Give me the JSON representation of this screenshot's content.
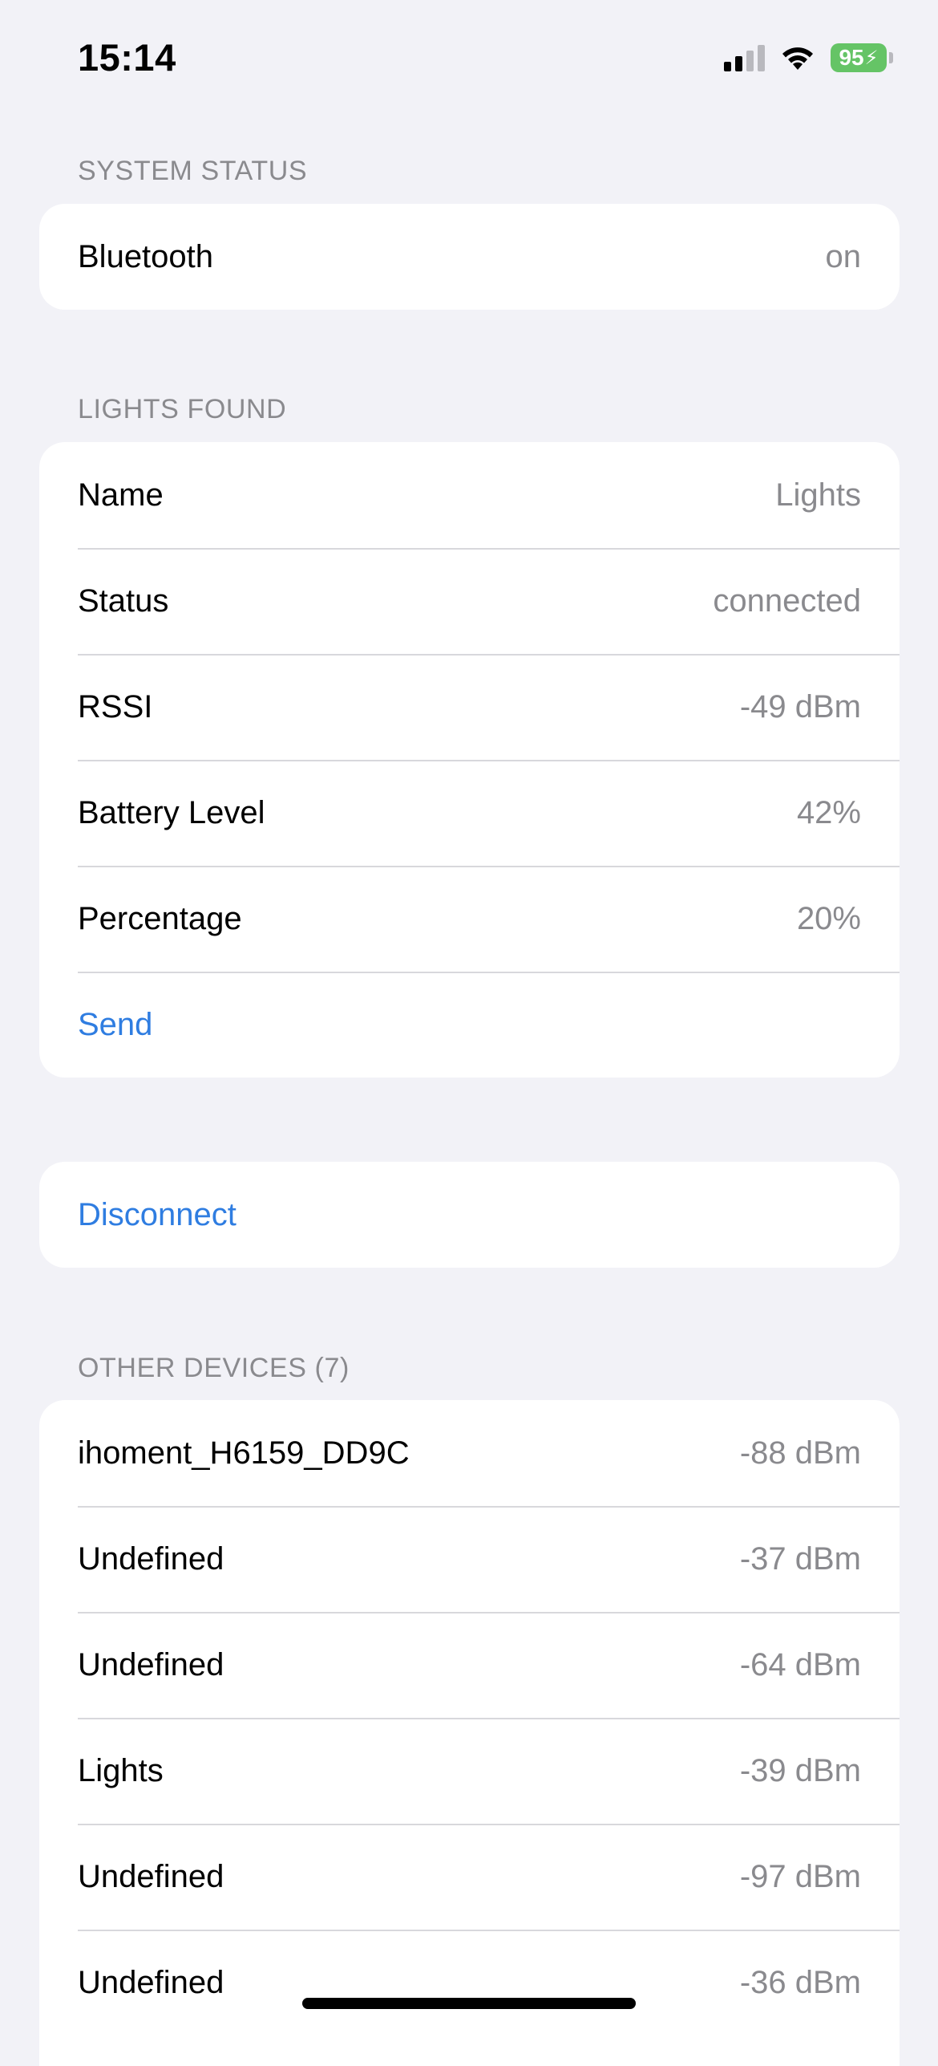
{
  "status_bar": {
    "time": "15:14",
    "battery": "95",
    "icons": [
      "cellular-signal-icon",
      "wifi-icon",
      "battery-charging-icon"
    ]
  },
  "system_status": {
    "header": "SYSTEM STATUS",
    "rows": [
      {
        "label": "Bluetooth",
        "value": "on"
      }
    ]
  },
  "lights_found": {
    "header": "LIGHTS FOUND",
    "rows": [
      {
        "label": "Name",
        "value": "Lights"
      },
      {
        "label": "Status",
        "value": "connected"
      },
      {
        "label": "RSSI",
        "value": "-49 dBm"
      },
      {
        "label": "Battery Level",
        "value": "42%"
      },
      {
        "label": "Percentage",
        "value": "20%"
      }
    ],
    "send_label": "Send"
  },
  "actions": {
    "disconnect_label": "Disconnect"
  },
  "other_devices": {
    "header": "OTHER DEVICES (7)",
    "rows": [
      {
        "label": "ihoment_H6159_DD9C",
        "value": "-88 dBm"
      },
      {
        "label": "Undefined",
        "value": "-37 dBm"
      },
      {
        "label": "Undefined",
        "value": "-64 dBm"
      },
      {
        "label": "Lights",
        "value": "-39 dBm"
      },
      {
        "label": "Undefined",
        "value": "-97 dBm"
      },
      {
        "label": "Undefined",
        "value": "-36 dBm"
      }
    ]
  },
  "colors": {
    "accent": "#2f7de1",
    "background": "#f2f2f7",
    "secondary_text": "#8a8a8e",
    "battery": "#65c466"
  }
}
